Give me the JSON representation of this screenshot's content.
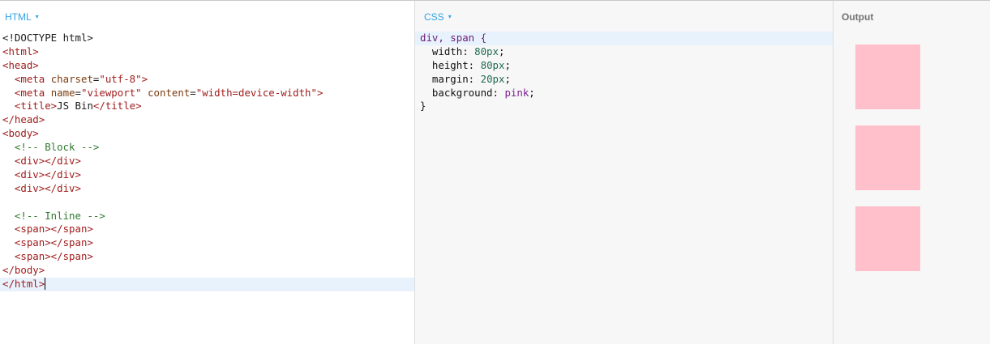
{
  "html_panel": {
    "title": "HTML",
    "caret": "▾",
    "lines": [
      [
        {
          "t": "<!DOCTYPE html>",
          "c": "plain"
        }
      ],
      [
        {
          "t": "<html>",
          "c": "tag"
        }
      ],
      [
        {
          "t": "<head>",
          "c": "tag"
        }
      ],
      [
        {
          "t": "  ",
          "c": "plain"
        },
        {
          "t": "<meta ",
          "c": "tag"
        },
        {
          "t": "charset",
          "c": "attr"
        },
        {
          "t": "=",
          "c": "plain"
        },
        {
          "t": "\"utf-8\"",
          "c": "str"
        },
        {
          "t": ">",
          "c": "tag"
        }
      ],
      [
        {
          "t": "  ",
          "c": "plain"
        },
        {
          "t": "<meta ",
          "c": "tag"
        },
        {
          "t": "name",
          "c": "attr"
        },
        {
          "t": "=",
          "c": "plain"
        },
        {
          "t": "\"viewport\"",
          "c": "str"
        },
        {
          "t": " ",
          "c": "plain"
        },
        {
          "t": "content",
          "c": "attr"
        },
        {
          "t": "=",
          "c": "plain"
        },
        {
          "t": "\"width=device-width\"",
          "c": "str"
        },
        {
          "t": ">",
          "c": "tag"
        }
      ],
      [
        {
          "t": "  ",
          "c": "plain"
        },
        {
          "t": "<title>",
          "c": "tag"
        },
        {
          "t": "JS Bin",
          "c": "plain"
        },
        {
          "t": "</title>",
          "c": "tag"
        }
      ],
      [
        {
          "t": "</head>",
          "c": "tag"
        }
      ],
      [
        {
          "t": "<body>",
          "c": "tag"
        }
      ],
      [
        {
          "t": "  ",
          "c": "plain"
        },
        {
          "t": "<!-- Block -->",
          "c": "cmt"
        }
      ],
      [
        {
          "t": "  ",
          "c": "plain"
        },
        {
          "t": "<div></div>",
          "c": "tag"
        }
      ],
      [
        {
          "t": "  ",
          "c": "plain"
        },
        {
          "t": "<div></div>",
          "c": "tag"
        }
      ],
      [
        {
          "t": "  ",
          "c": "plain"
        },
        {
          "t": "<div></div>",
          "c": "tag"
        }
      ],
      [
        {
          "t": "",
          "c": "plain"
        }
      ],
      [
        {
          "t": "  ",
          "c": "plain"
        },
        {
          "t": "<!-- Inline -->",
          "c": "cmt"
        }
      ],
      [
        {
          "t": "  ",
          "c": "plain"
        },
        {
          "t": "<span></span>",
          "c": "tag"
        }
      ],
      [
        {
          "t": "  ",
          "c": "plain"
        },
        {
          "t": "<span></span>",
          "c": "tag"
        }
      ],
      [
        {
          "t": "  ",
          "c": "plain"
        },
        {
          "t": "<span></span>",
          "c": "tag"
        }
      ],
      [
        {
          "t": "</body>",
          "c": "tag"
        }
      ],
      [
        {
          "t": "</html>",
          "c": "tag"
        }
      ]
    ],
    "active_line": 18
  },
  "css_panel": {
    "title": "CSS",
    "caret": "▾",
    "lines": [
      [
        {
          "t": "div, span {",
          "c": "sel"
        }
      ],
      [
        {
          "t": "  width: ",
          "c": "prop"
        },
        {
          "t": "80px",
          "c": "num"
        },
        {
          "t": ";",
          "c": "prop"
        }
      ],
      [
        {
          "t": "  height: ",
          "c": "prop"
        },
        {
          "t": "80px",
          "c": "num"
        },
        {
          "t": ";",
          "c": "prop"
        }
      ],
      [
        {
          "t": "  margin: ",
          "c": "prop"
        },
        {
          "t": "20px",
          "c": "num"
        },
        {
          "t": ";",
          "c": "prop"
        }
      ],
      [
        {
          "t": "  background: ",
          "c": "prop"
        },
        {
          "t": "pink",
          "c": "kw"
        },
        {
          "t": ";",
          "c": "prop"
        }
      ],
      [
        {
          "t": "}",
          "c": "prop"
        }
      ]
    ],
    "active_line": 0
  },
  "output_panel": {
    "title": "Output",
    "box_color": "#ffc0cb",
    "box_count": 3
  }
}
